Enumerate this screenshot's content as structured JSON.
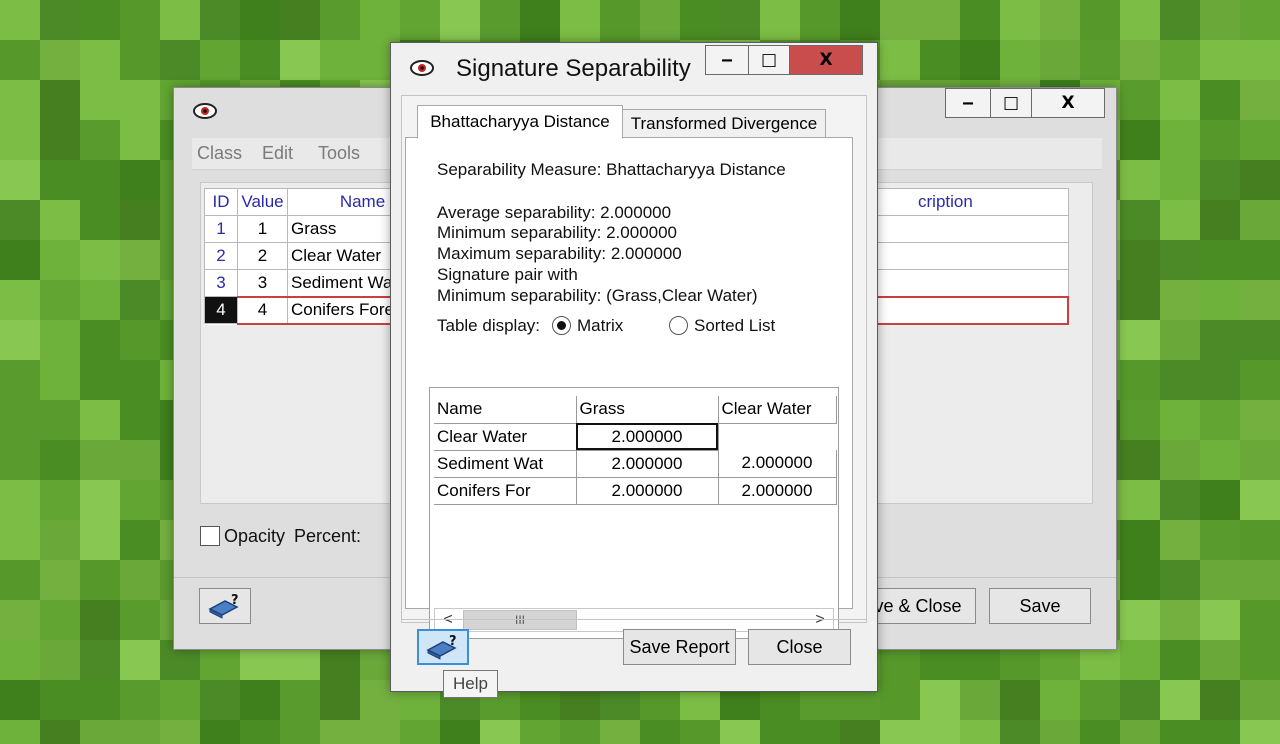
{
  "back_window": {
    "menu": [
      "Class",
      "Edit",
      "Tools"
    ],
    "table": {
      "headers": [
        "ID",
        "Value",
        "Name",
        "cription"
      ],
      "rows": [
        {
          "id": "1",
          "value": "1",
          "name": "Grass"
        },
        {
          "id": "2",
          "value": "2",
          "name": "Clear Water"
        },
        {
          "id": "3",
          "value": "3",
          "name": "Sediment Wa"
        },
        {
          "id": "4",
          "value": "4",
          "name": "Conifers Fore"
        }
      ]
    },
    "opacity_label": "Opacity",
    "percent_label": "Percent:",
    "save_close_label": "ave & Close",
    "save_label": "Save",
    "caption_buttons": {
      "minimize": "‒",
      "maximize": "□",
      "close": "X"
    }
  },
  "dialog": {
    "title": "Signature Separability",
    "tabs": [
      "Bhattacharyya Distance",
      "Transformed Divergence"
    ],
    "measure_line": "Separability Measure: Bhattacharyya Distance",
    "stats": [
      "Average separability: 2.000000",
      "Minimum separability: 2.000000",
      "Maximum separability: 2.000000",
      "Signature pair with",
      "Minimum separability: (Grass,Clear Water)"
    ],
    "table_display_label": "Table display:",
    "display_options": [
      "Matrix",
      "Sorted List"
    ],
    "selected_display": "Matrix",
    "matrix": {
      "columns": [
        "Name",
        "Grass",
        "Clear Water"
      ],
      "rows": [
        {
          "name": "Clear Water",
          "grass": "2.000000",
          "clear_water": ""
        },
        {
          "name": "Sediment Wat",
          "grass": "2.000000",
          "clear_water": "2.000000"
        },
        {
          "name": "Conifers For",
          "grass": "2.000000",
          "clear_water": "2.000000"
        }
      ]
    },
    "scroll_thumb": "III",
    "save_report_label": "Save Report",
    "close_label": "Close",
    "help_tooltip": "Help",
    "caption_buttons": {
      "minimize": "‒",
      "maximize": "□",
      "close": "X"
    }
  },
  "colors": {
    "close_button": "#c94d4d",
    "link_blue": "#2a2aa8",
    "selection_red": "#c94040",
    "desktop_green": "#4a8a22"
  }
}
